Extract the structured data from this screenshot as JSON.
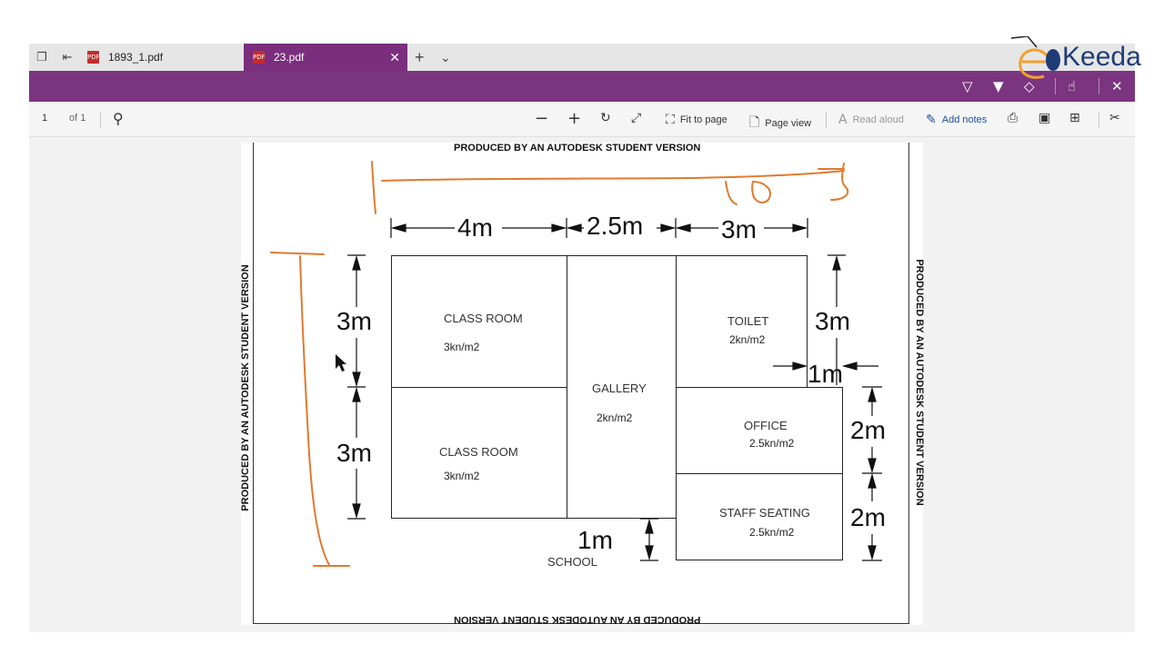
{
  "tabs": [
    {
      "label": "1893_1.pdf",
      "active": false
    },
    {
      "label": "23.pdf",
      "active": true
    }
  ],
  "toolbar": {
    "page_number": "1",
    "page_total": "of 1",
    "fit_to_page": "Fit to page",
    "page_view": "Page view",
    "read_aloud": "Read aloud",
    "add_notes": "Add notes"
  },
  "drawing": {
    "watermark": "PRODUCED BY AN AUTODESK STUDENT VERSION",
    "rooms": [
      {
        "name": "CLASS ROOM",
        "load": "3kn/m2"
      },
      {
        "name": "CLASS ROOM",
        "load": "3kn/m2"
      },
      {
        "name": "GALLERY",
        "load": "2kn/m2"
      },
      {
        "name": "TOILET",
        "load": "2kn/m2"
      },
      {
        "name": "OFFICE",
        "load": "2.5kn/m2"
      },
      {
        "name": "STAFF SEATING",
        "load": "2.5kn/m2"
      }
    ],
    "dims": {
      "top_1": "4m",
      "top_2": "2.5m",
      "top_3": "3m",
      "left_1": "3m",
      "left_2": "3m",
      "right_toilet": "3m",
      "toilet_offset": "1m",
      "right_office": "2m",
      "right_staff": "2m",
      "bottom_gap": "1m"
    },
    "caption": "SCHOOL"
  },
  "annotation": {
    "handwritten_text": "10.5"
  },
  "logo": {
    "text": "Keeda"
  },
  "colors": {
    "ribbon": "#7b3580",
    "accent": "#1a4fa0",
    "ink": "#e07a2e"
  }
}
